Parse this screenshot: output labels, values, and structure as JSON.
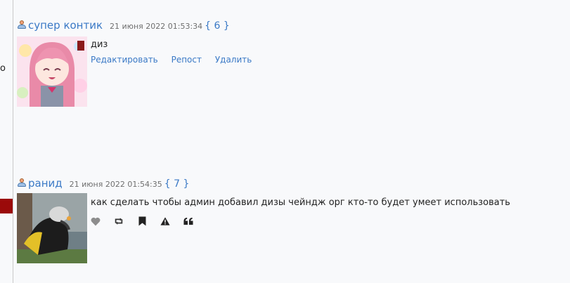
{
  "left_fragment": "о",
  "posts": [
    {
      "username": "супер контик",
      "timestamp": "21 июня 2022 01:53:34",
      "number": "{ 6 }",
      "message": "диз",
      "actions": [
        "Редактировать",
        "Репост",
        "Удалить"
      ]
    },
    {
      "username": "ранид",
      "timestamp": "21 июня 2022 01:54:35",
      "number": "{ 7 }",
      "message": "как сделать чтобы админ добавил дизы чейндж орг кто-то будет умеет использовать",
      "icons": [
        "heart-icon",
        "repost-icon",
        "bookmark-icon",
        "warning-icon",
        "quote-icon"
      ]
    }
  ],
  "colors": {
    "link": "#3a79c6",
    "timestamp": "#6f6f6f",
    "background": "#f8f9fb",
    "marker": "#9b0a0a"
  }
}
